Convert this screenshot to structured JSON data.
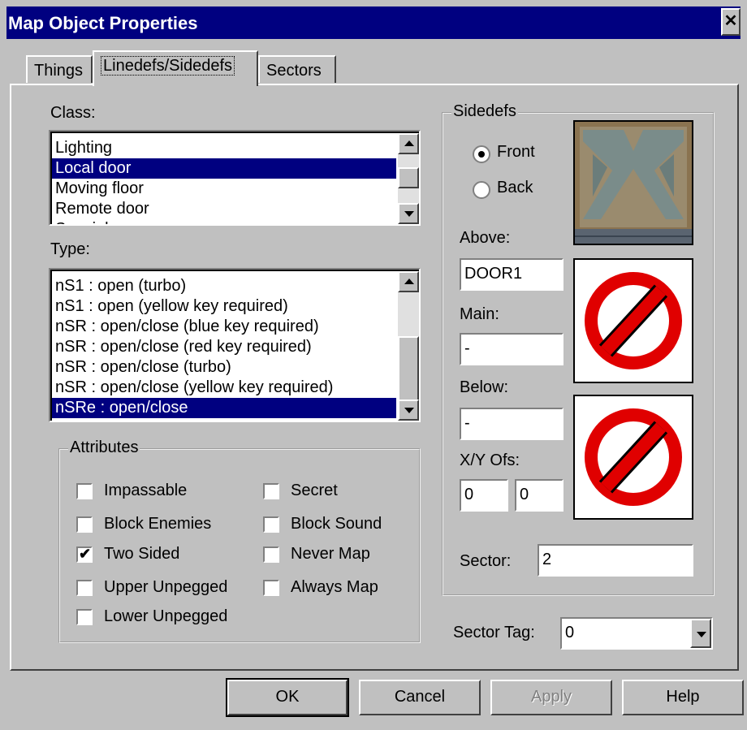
{
  "window": {
    "title": "Map Object Properties",
    "close_glyph": "✕"
  },
  "tabs": [
    {
      "label": "Things"
    },
    {
      "label": "Linedefs/Sidedefs"
    },
    {
      "label": "Sectors"
    }
  ],
  "class_section": {
    "label": "Class:",
    "items": [
      "Lighting",
      "Local door",
      "Moving floor",
      "Remote door",
      "Special"
    ],
    "selected": "Local door"
  },
  "type_section": {
    "label": "Type:",
    "items": [
      "nS1 : open (turbo)",
      "nS1 : open (yellow key required)",
      "nSR : open/close (blue key required)",
      "nSR : open/close (red key required)",
      "nSR : open/close (turbo)",
      "nSR : open/close (yellow key required)",
      "nSRe : open/close"
    ],
    "selected": "nSRe : open/close"
  },
  "attributes": {
    "label": "Attributes",
    "left": [
      {
        "label": "Impassable",
        "checked": false
      },
      {
        "label": "Block Enemies",
        "checked": false
      },
      {
        "label": "Two Sided",
        "checked": true
      },
      {
        "label": "Upper Unpegged",
        "checked": false
      },
      {
        "label": "Lower Unpegged",
        "checked": false
      }
    ],
    "right": [
      {
        "label": "Secret",
        "checked": false
      },
      {
        "label": "Block Sound",
        "checked": false
      },
      {
        "label": "Never Map",
        "checked": false
      },
      {
        "label": "Always Map",
        "checked": false
      }
    ],
    "check_glyph": "✔"
  },
  "sidedefs": {
    "label": "Sidedefs",
    "front_label": "Front",
    "back_label": "Back",
    "selected_side": "Front",
    "above_label": "Above:",
    "above_value": "DOOR1",
    "main_label": "Main:",
    "main_value": "-",
    "below_label": "Below:",
    "below_value": "-",
    "offset_label": "X/Y Ofs:",
    "x_offset": "0",
    "y_offset": "0",
    "sector_label": "Sector:",
    "sector_value": "2"
  },
  "sector_tag": {
    "label": "Sector Tag:",
    "value": "0"
  },
  "buttons": {
    "ok": "OK",
    "cancel": "Cancel",
    "apply": "Apply",
    "help": "Help"
  },
  "colors": {
    "title_bar": "#000080",
    "face": "#c0c0c0",
    "selection": "#000080",
    "no_sign_red": "#e00000"
  }
}
